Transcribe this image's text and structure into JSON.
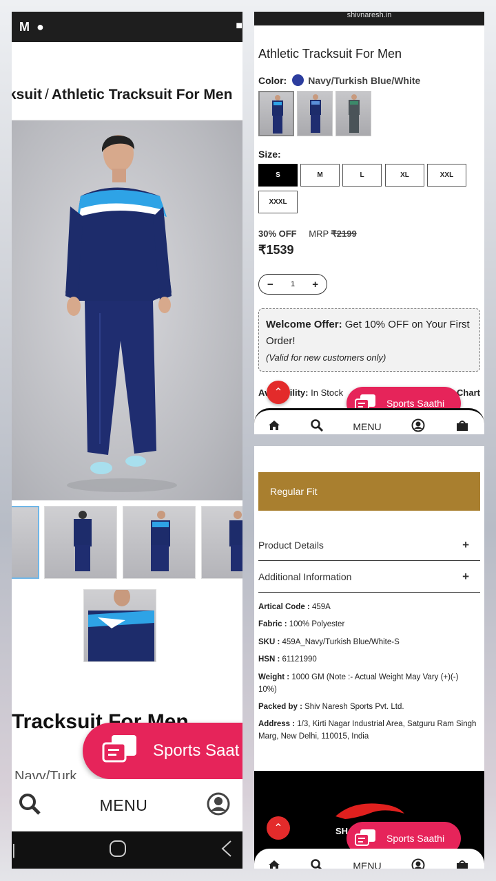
{
  "left": {
    "breadcrumb_prev": "ksuit",
    "breadcrumb_sep": "/",
    "breadcrumb_current": "Athletic Tracksuit For Men",
    "title_partial": "Tracksuit For Men",
    "subtitle_partial": "Navy/Turk",
    "saathi_label": "Sports Saat",
    "nav_menu": "MENU"
  },
  "right_top": {
    "url": "shivnaresh.in",
    "title": "Athletic Tracksuit For Men",
    "color_label": "Color:",
    "color_name": "Navy/Turkish Blue/White",
    "color_hex": "#2c3d9e",
    "size_label": "Size:",
    "sizes": [
      "S",
      "M",
      "L",
      "XL",
      "XXL",
      "XXXL"
    ],
    "selected_size": "S",
    "discount": "30% OFF",
    "mrp_label": "MRP",
    "mrp_value": "₹2199",
    "price": "₹1539",
    "qty_minus": "−",
    "qty": "1",
    "qty_plus": "+",
    "offer_title": "Welcome Offer:",
    "offer_text": " Get 10% OFF on Your First Order!",
    "offer_note": "(Valid for new customers only)",
    "avail_label": "Availability:",
    "avail_value": "In Stock",
    "size_chart": "Chart",
    "saathi_label": "Sports Saathi",
    "nav_menu": "MENU"
  },
  "right_bottom": {
    "fit_label": "Regular Fit",
    "acc_product_details": "Product Details",
    "acc_additional_info": "Additional Information",
    "acc_plus": "+",
    "specs": [
      {
        "k": "Artical Code :",
        "v": " 459A"
      },
      {
        "k": "Fabric :",
        "v": " 100% Polyester"
      },
      {
        "k": "SKU :",
        "v": " 459A_Navy/Turkish Blue/White-S"
      },
      {
        "k": "HSN :",
        "v": " 61121990"
      },
      {
        "k": "Weight :",
        "v": " 1000 GM (Note :- Actual Weight May Vary (+)(-) 10%)"
      },
      {
        "k": "Packed by :",
        "v": " Shiv Naresh Sports Pvt. Ltd."
      },
      {
        "k": "Address :",
        "v": " 1/3, Kirti Nagar Industrial Area, Satguru Ram Singh Marg, New Delhi, 110015, India"
      }
    ],
    "brand_partial": "SH",
    "saathi_label": "Sports Saathi",
    "nav_menu": "MENU"
  },
  "colors": {
    "accent_pink": "#e6245a",
    "fit_bar": "#a97f2f",
    "scroll_top": "#e32b2b"
  }
}
